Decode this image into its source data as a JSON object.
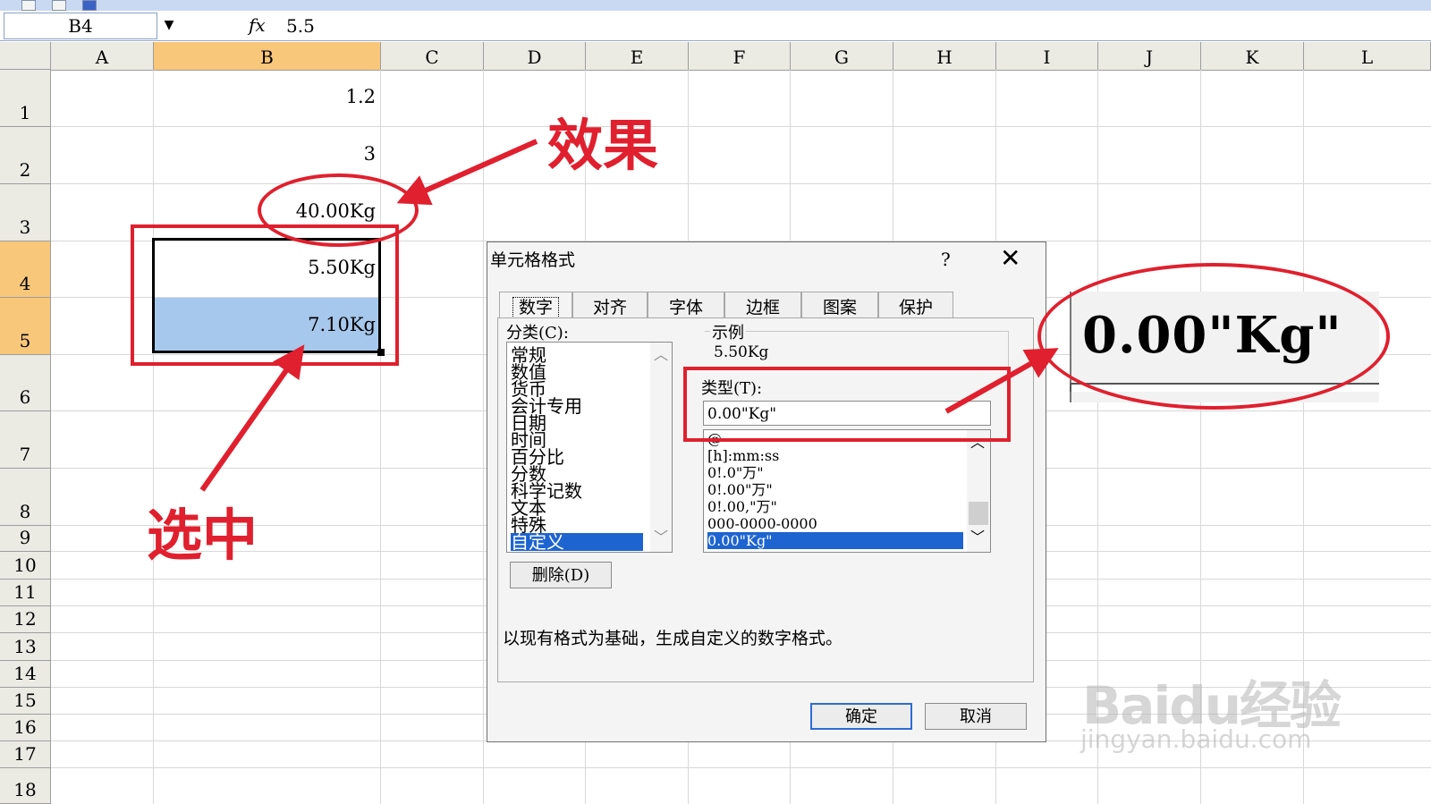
{
  "formula_bar": {
    "name_box": "B4",
    "dropdown_glyph": "▼",
    "fx_label": "fx",
    "value": "5.5"
  },
  "columns": [
    "A",
    "B",
    "C",
    "D",
    "E",
    "F",
    "G",
    "H",
    "I",
    "J",
    "K",
    "L"
  ],
  "selected_column": "B",
  "rows": [
    "1",
    "2",
    "3",
    "4",
    "5",
    "6",
    "7",
    "8",
    "9",
    "10",
    "11",
    "12",
    "13",
    "14",
    "15",
    "16",
    "17",
    "18"
  ],
  "selected_rows": [
    "4",
    "5"
  ],
  "cells": {
    "B1": "1.2",
    "B2": "3",
    "B3": "40.00Kg",
    "B4": "5.50Kg",
    "B5": "7.10Kg"
  },
  "annotations": {
    "effect_label": "效果",
    "selected_label": "选中",
    "color": "#e0202e"
  },
  "dialog": {
    "title": "单元格格式",
    "help": "?",
    "close": "✕",
    "tabs": [
      "数字",
      "对齐",
      "字体",
      "边框",
      "图案",
      "保护"
    ],
    "active_tab": "数字",
    "category_label": "分类(C):",
    "categories": [
      "常规",
      "数值",
      "货币",
      "会计专用",
      "日期",
      "时间",
      "百分比",
      "分数",
      "科学记数",
      "文本",
      "特殊",
      "自定义"
    ],
    "selected_category": "自定义",
    "sample_label": "示例",
    "sample_value": "5.50Kg",
    "type_label": "类型(T):",
    "type_value": "0.00\"Kg\"",
    "type_list": [
      "@",
      "[h]:mm:ss",
      "0!.0\"万\"",
      "0!.00\"万\"",
      "0!.00,\"万\"",
      "000-0000-0000",
      "0.00\"Kg\""
    ],
    "selected_type": "0.00\"Kg\"",
    "delete_button": "删除(D)",
    "description": "以现有格式为基础，生成自定义的数字格式。",
    "ok_button": "确定",
    "cancel_button": "取消",
    "selection_color": "#1e64d0"
  },
  "zoom_callout": {
    "text": "0.00\"Kg\""
  },
  "watermark": {
    "logo": "Baidu经验",
    "url": "jingyan.baidu.com"
  }
}
